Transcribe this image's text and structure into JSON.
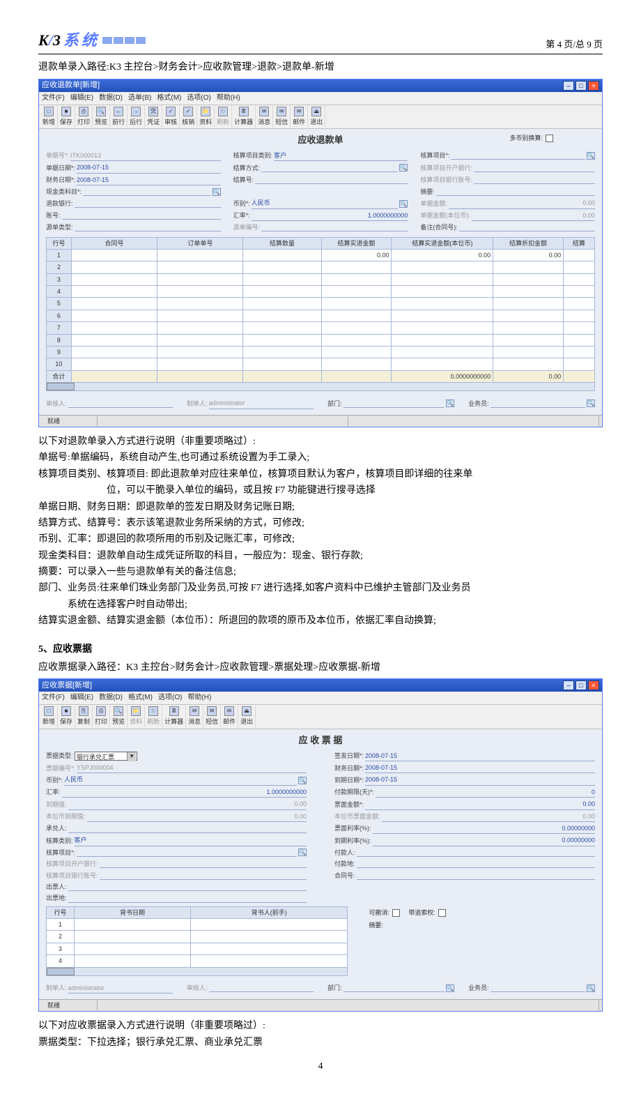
{
  "header": {
    "logo_text": "K/3 系统",
    "page_info": "第 4 页/总 9 页"
  },
  "path1": "退款单录入路径:K3 主控台>财务会计>应收款管理>退款>退款单-新增",
  "win1": {
    "title": "应收退款单[新增]",
    "menu": [
      "文件(F)",
      "编辑(E)",
      "数据(D)",
      "选单(B)",
      "格式(M)",
      "选项(O)",
      "帮助(H)"
    ],
    "toolbar": [
      "新增",
      "保存",
      "打印",
      "预览",
      "前行",
      "后行",
      "凭证",
      "审核",
      "核销",
      "资料",
      "刷新",
      "计算器",
      "消息",
      "短信",
      "邮件",
      "退出"
    ],
    "form_title": "应收退款单",
    "multi_currency_label": "多币别换算:",
    "fields": {
      "doc_no_label": "单据号*:",
      "doc_no": "ITK000013",
      "acct_cat_label": "核算项目类别:",
      "acct_cat": "客户",
      "acct_item_label": "核算项目*:",
      "doc_date_label": "单据日期*:",
      "doc_date": "2008-07-15",
      "settle_method_label": "结算方式:",
      "acct_bank_label": "核算项目开户银行:",
      "fin_date_label": "财务日期*:",
      "fin_date": "2008-07-15",
      "settle_no_label": "结算号:",
      "acct_bankno_label": "核算项目银行账号:",
      "cash_subj_label": "现金类科目*:",
      "summary_label": "摘要:",
      "refund_bank_label": "退款银行:",
      "currency_label": "币别*:",
      "currency": "人民币",
      "doc_amt_label": "单据金额:",
      "doc_amt": "0.00",
      "account_label": "账号:",
      "rate_label": "汇率*:",
      "rate": "1.0000000000",
      "doc_amt_base_label": "单据金额(本位币):",
      "doc_amt_base": "0.00",
      "src_type_label": "源单类型:",
      "src_no_label": "源单编号:",
      "remark_label": "备注(合同号):"
    },
    "table": {
      "cols": [
        "行号",
        "合同号",
        "订单单号",
        "结算数量",
        "结算实退金额",
        "结算实退金额(本位币)",
        "结算折扣金额",
        "结算"
      ],
      "rows": [
        "1",
        "2",
        "3",
        "4",
        "5",
        "6",
        "7",
        "8",
        "9",
        "10"
      ],
      "sum_label": "合计",
      "cell_r1c5": "0.00",
      "cell_r1c6": "0.00",
      "cell_r1c7": "0.00",
      "sum_c6": "0.0000000000",
      "sum_c7": "0.00"
    },
    "footer": {
      "审核人:": "",
      "制单人:": "administrator",
      "部门:": "",
      "业务员:": ""
    },
    "status": "就绪"
  },
  "desc1": {
    "intro": "以下对退款单录入方式进行说明（非重要项略过）:",
    "l1": "单据号:单据编码，系统自动产生,也可通过系统设置为手工录入;",
    "l2": "核算项目类别、核算项目: 即此退款单对应往来单位，核算项目默认为客户，核算项目即详细的往来单",
    "l2b": "位，可以干脆录入单位的编码，或且按 F7 功能键进行搜寻选择",
    "l3": "单据日期、财务日期：即退款单的签发日期及财务记账日期;",
    "l4": "结算方式、结算号：表示该笔退款业务所采纳的方式，可修改;",
    "l5": "币别、汇率：即退回的款项所用的币别及记账汇率，可修改;",
    "l6": "现金类科目：退款单自动生成凭证所取的科目，一般应为：现金、银行存款;",
    "l7": "摘要：可以录入一些与退款单有关的备注信息;",
    "l8": "部门、业务员:往来单们珠业务部门及业务员,可按 F7 进行选择,如客户资料中已维护主管部门及业务员",
    "l8b": "系统在选择客户时自动带出;",
    "l9": "结算实退金额、结算实退金额（本位币）：所退回的款项的原币及本位币，依据汇率自动换算;"
  },
  "section5_title": "5、应收票据",
  "path2": "应收票据录入路径：K3 主控台>财务会计>应收款管理>票据处理>应收票据-新增",
  "win2": {
    "title": "应收票据[新增]",
    "menu": [
      "文件(F)",
      "编辑(E)",
      "数据(D)",
      "格式(M)",
      "选项(O)",
      "帮助(H)"
    ],
    "toolbar": [
      "新增",
      "保存",
      "复制",
      "打印",
      "预览",
      "资料",
      "刷新",
      "计算器",
      "消息",
      "短信",
      "邮件",
      "退出"
    ],
    "form_title": "应 收 票 据",
    "left": {
      "bill_type_label": "票据类型:",
      "bill_type": "银行承兑汇票",
      "bill_no_label": "票据编号*:",
      "bill_no": "YSPJ000004",
      "currency_label": "币别*:",
      "currency": "人民币",
      "rate_label": "汇率:",
      "rate": "1.0000000000",
      "due_val_label": "到期值:",
      "due_val": "0.00",
      "base_due_label": "本位币到期值:",
      "base_due": "0.00",
      "acceptor_label": "承兑人:",
      "acct_cat_label": "核算类别:",
      "acct_cat": "客户",
      "acct_item_label": "核算项目*:",
      "acct_bank_label": "核算项目开户银行:",
      "acct_bankno_label": "核算项目银行账号:",
      "drawer_label": "出票人:",
      "draw_place_label": "出票地:"
    },
    "right": {
      "sign_date_label": "签发日期*:",
      "sign_date": "2008-07-15",
      "fin_date_label": "财务日期*:",
      "fin_date": "2008-07-15",
      "due_date_label": "到期日期*:",
      "due_date": "2008-07-15",
      "pay_term_label": "付款期限(天)*:",
      "pay_term": "0",
      "face_amt_label": "票面金额*:",
      "face_amt": "0.00",
      "base_face_label": "本位币票面金额:",
      "base_face": "0.00",
      "face_rate_label": "票面利率(%):",
      "face_rate": "0.00000000",
      "due_rate_label": "到期利率(%):",
      "due_rate": "0.00000000",
      "payer_label": "付款人:",
      "pay_place_label": "付款地:",
      "contract_label": "合同号:"
    },
    "endorse": {
      "cols": [
        "行号",
        "背书日期",
        "背书人(前手)"
      ],
      "rows": [
        "1",
        "2",
        "3",
        "4"
      ]
    },
    "extras": {
      "revocable": "可撤消:",
      "with_recourse": "带追索权:",
      "summary": "摘要:"
    },
    "footer": {
      "制单人:": "administrator",
      "审核人:": "",
      "部门:": "",
      "业务员:": ""
    },
    "status": "就绪"
  },
  "desc2": {
    "intro": "以下对应收票据录入方式进行说明（非重要项略过）:",
    "l1": "票据类型：下拉选择；银行承兑汇票、商业承兑汇票"
  },
  "page_num": "4"
}
